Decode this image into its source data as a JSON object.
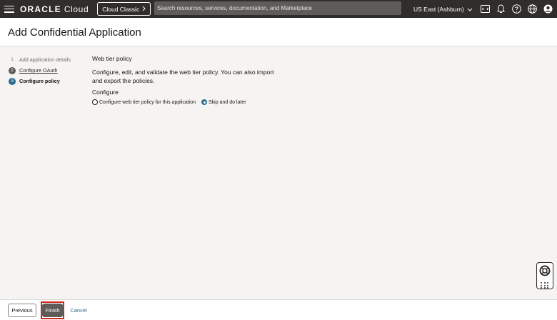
{
  "topbar": {
    "brand": "ORACLE",
    "brand_suffix": "Cloud",
    "cloud_classic_label": "Cloud Classic",
    "search_placeholder": "Search resources, services, documentation, and Marketplace",
    "region": "US East (Ashburn)"
  },
  "header": {
    "title": "Add Confidential Application"
  },
  "steps": [
    {
      "number": "1",
      "label": "Add application details",
      "state": "done"
    },
    {
      "number": "2",
      "label": "Configure OAuth",
      "state": "link"
    },
    {
      "number": "3",
      "label": "Configure policy",
      "state": "current"
    }
  ],
  "main": {
    "section_title": "Web tier policy",
    "description": "Configure, edit, and validate the web tier policy. You can also import and export the policies.",
    "configure_label": "Configure",
    "options": [
      {
        "label": "Configure web tier policy for this application",
        "selected": false
      },
      {
        "label": "Skip and do later",
        "selected": true
      }
    ]
  },
  "footer": {
    "previous_label": "Previous",
    "finish_label": "Finish",
    "cancel_label": "Cancel"
  },
  "colors": {
    "topbar_bg": "#312d2a",
    "accent": "#2b6b8e",
    "highlight": "#d32a20"
  }
}
